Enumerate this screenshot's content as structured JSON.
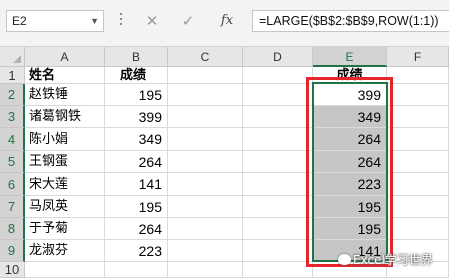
{
  "formula_bar": {
    "name_box": "E2",
    "cancel_icon": "✕",
    "enter_icon": "✓",
    "fx_label": "fx",
    "formula": "=LARGE($B$2:$B$9,ROW(1:1))"
  },
  "columns": [
    "A",
    "B",
    "C",
    "D",
    "E",
    "F"
  ],
  "rows": [
    "1",
    "2",
    "3",
    "4",
    "5",
    "6",
    "7",
    "8",
    "9",
    "10"
  ],
  "headers": {
    "name": "姓名",
    "score": "成绩",
    "result": "成绩"
  },
  "data": [
    {
      "name": "赵铁锤",
      "score": "195"
    },
    {
      "name": "诸葛钢铁",
      "score": "399"
    },
    {
      "name": "陈小娟",
      "score": "349"
    },
    {
      "name": "王钢蛋",
      "score": "264"
    },
    {
      "name": "宋大莲",
      "score": "141"
    },
    {
      "name": "马凤英",
      "score": "195"
    },
    {
      "name": "于予菊",
      "score": "264"
    },
    {
      "name": "龙淑芬",
      "score": "223"
    }
  ],
  "results": [
    "399",
    "349",
    "264",
    "264",
    "223",
    "195",
    "195",
    "141"
  ],
  "selection": {
    "active_cell": "E2",
    "range": "E2:E9",
    "highlight_color": "#e3262b"
  },
  "watermark": "Excel学习世界"
}
